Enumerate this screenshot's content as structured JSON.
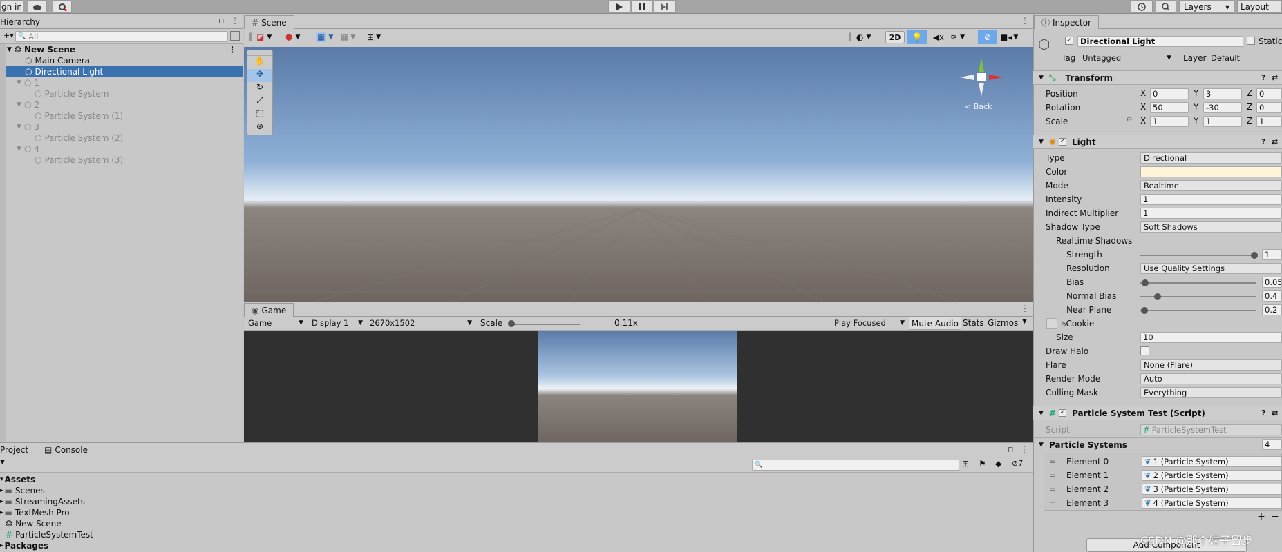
{
  "topbar": {
    "signin": "gn in",
    "layers": "Layers",
    "layout": "Layout"
  },
  "hierarchy": {
    "title": "Hierarchy",
    "search_placeholder": "All",
    "scene": "New Scene",
    "items": [
      {
        "label": "Main Camera"
      },
      {
        "label": "Directional Light"
      },
      {
        "label": "1"
      },
      {
        "label": "Particle System"
      },
      {
        "label": "2"
      },
      {
        "label": "Particle System (1)"
      },
      {
        "label": "3"
      },
      {
        "label": "Particle System (2)"
      },
      {
        "label": "4"
      },
      {
        "label": "Particle System (3)"
      }
    ]
  },
  "scene": {
    "tab": "Scene",
    "btn_2d": "2D",
    "back": "Back"
  },
  "game": {
    "tab": "Game",
    "mode": "Game",
    "display": "Display 1",
    "resolution": "2670x1502",
    "scale_label": "Scale",
    "scale_value": "0.11x",
    "play_focused": "Play Focused",
    "mute_audio": "Mute Audio",
    "stats": "Stats",
    "gizmos": "Gizmos"
  },
  "project": {
    "tab_project": "Project",
    "tab_console": "Console",
    "hidden_count": "7",
    "items": [
      {
        "label": "Assets"
      },
      {
        "label": "Scenes"
      },
      {
        "label": "StreamingAssets"
      },
      {
        "label": "TextMesh Pro"
      },
      {
        "label": "New Scene"
      },
      {
        "label": "ParticleSystemTest"
      },
      {
        "label": "Packages"
      }
    ]
  },
  "inspector": {
    "tab": "Inspector",
    "object_name": "Directional Light",
    "static": "Static",
    "tag_label": "Tag",
    "tag_value": "Untagged",
    "layer_label": "Layer",
    "layer_value": "Default",
    "transform": {
      "title": "Transform",
      "position": "Position",
      "rotation": "Rotation",
      "scale": "Scale",
      "pos": [
        "0",
        "3",
        "0"
      ],
      "rot": [
        "50",
        "-30",
        "0"
      ],
      "scl": [
        "1",
        "1",
        "1"
      ],
      "x": "X",
      "y": "Y",
      "z": "Z"
    },
    "light": {
      "title": "Light",
      "rows": [
        {
          "label": "Type",
          "value": "Directional"
        },
        {
          "label": "Color",
          "value": ""
        },
        {
          "label": "Mode",
          "value": "Realtime"
        },
        {
          "label": "Intensity",
          "value": "1"
        },
        {
          "label": "Indirect Multiplier",
          "value": "1"
        },
        {
          "label": "Shadow Type",
          "value": "Soft Shadows"
        }
      ],
      "realtime_shadows": "Realtime Shadows",
      "strength": "Strength",
      "strength_value": "1",
      "resolution": "Resolution",
      "resolution_value": "Use Quality Settings",
      "bias": "Bias",
      "bias_value": "0.05",
      "normal_bias": "Normal Bias",
      "normal_bias_value": "0.4",
      "near_plane": "Near Plane",
      "near_plane_value": "0.2",
      "cookie": "Cookie",
      "size": "Size",
      "size_value": "10",
      "draw_halo": "Draw Halo",
      "flare": "Flare",
      "flare_value": "None (Flare)",
      "render_mode": "Render Mode",
      "render_mode_value": "Auto",
      "culling_mask": "Culling Mask",
      "culling_mask_value": "Everything"
    },
    "script": {
      "title": "Particle System Test (Script)",
      "script_label": "Script",
      "script_value": "ParticleSystemTest",
      "ps_label": "Particle Systems",
      "ps_count": "4",
      "elements": [
        {
          "label": "Element 0",
          "value": "1 (Particle System)"
        },
        {
          "label": "Element 1",
          "value": "2 (Particle System)"
        },
        {
          "label": "Element 2",
          "value": "3 (Particle System)"
        },
        {
          "label": "Element 3",
          "value": "4 (Particle System)"
        }
      ]
    },
    "add_component": "Add Component"
  },
  "watermark": "CSDN @那个妹子留步"
}
